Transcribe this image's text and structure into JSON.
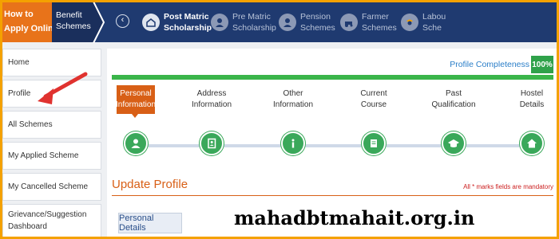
{
  "topbar": {
    "how_to": "How to",
    "apply_online": "Apply Online ?",
    "benefit_line1": "Benefit",
    "benefit_line2": "Schemes",
    "prev_glyph": "‹",
    "schemes": [
      {
        "line1": "Post Matric",
        "line2": "Scholarship",
        "icon": "post-matric-icon",
        "active": true
      },
      {
        "line1": "Pre Matric",
        "line2": "Scholarship",
        "icon": "pre-matric-icon",
        "active": false
      },
      {
        "line1": "Pension",
        "line2": "Schemes",
        "icon": "pension-icon",
        "active": false
      },
      {
        "line1": "Farmer",
        "line2": "Schemes",
        "icon": "farmer-icon",
        "active": false
      },
      {
        "line1": "Labou",
        "line2": "Sche",
        "icon": "labour-icon",
        "active": false
      }
    ]
  },
  "sidebar": {
    "items": [
      {
        "label": "Home"
      },
      {
        "label": "Profile"
      },
      {
        "label": "All Schemes"
      },
      {
        "label": "My Applied Scheme"
      },
      {
        "label": "My Cancelled Scheme"
      },
      {
        "label_line1": "Grievance/Suggestion",
        "label_line2": "Dashboard"
      }
    ]
  },
  "profile": {
    "completeness_label": "Profile Completeness",
    "completeness_pct": "100%",
    "completeness_value": 1.0,
    "steps": [
      {
        "line1": "Personal",
        "line2": "Information",
        "icon": "user-icon",
        "active": true
      },
      {
        "line1": "Address",
        "line2": "Information",
        "icon": "address-book-icon",
        "active": false
      },
      {
        "line1": "Other",
        "line2": "Information",
        "icon": "info-icon",
        "active": false
      },
      {
        "line1": "Current",
        "line2": "Course",
        "icon": "book-icon",
        "active": false
      },
      {
        "line1": "Past",
        "line2": "Qualification",
        "icon": "graduation-cap-icon",
        "active": false
      },
      {
        "line1": "Hostel",
        "line2": "Details",
        "icon": "home-icon",
        "active": false
      }
    ],
    "update_title": "Update Profile",
    "mandatory_note": "All * marks fields are mandatory",
    "personal_tab": "Personal Details"
  },
  "watermark": "mahadbtmahait.org.in",
  "colors": {
    "frame": "#f4a100",
    "topbar": "#1f3a70",
    "how_to_bg": "#e8731a",
    "accent_orange": "#d85f16",
    "progress_green": "#3ab54a",
    "step_green": "#3aa85a",
    "link_blue": "#2a7ec8"
  }
}
